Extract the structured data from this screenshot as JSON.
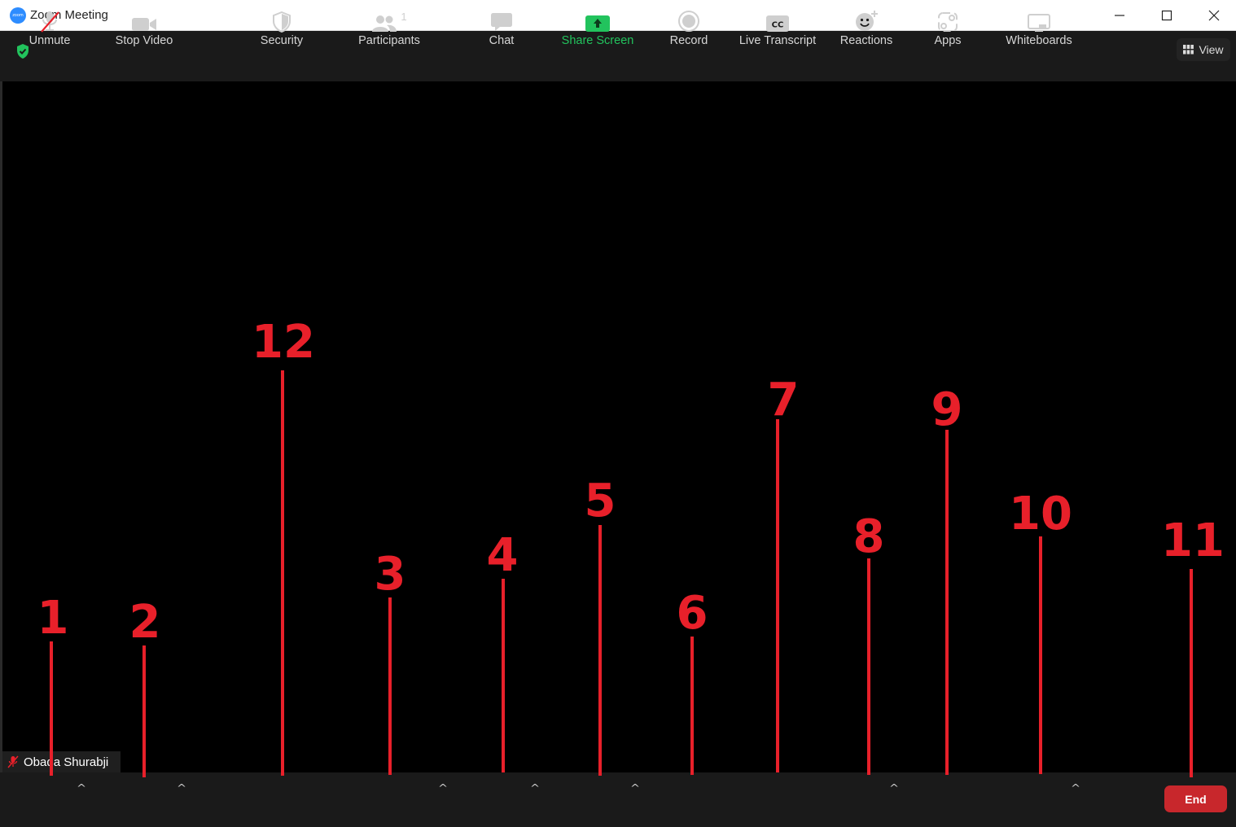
{
  "window": {
    "title": "Zoom Meeting",
    "logo_text": "zoom",
    "controls": [
      "minimize-icon",
      "maximize-icon",
      "close-icon"
    ]
  },
  "topbar": {
    "security_badge_icon": "shield-check-icon",
    "view_label": "View"
  },
  "participant": {
    "name": "Obada Shurabji",
    "muted": true
  },
  "toolbar": {
    "unmute": "Unmute",
    "stop_video": "Stop Video",
    "security": "Security",
    "participants": "Participants",
    "participants_count": "1",
    "chat": "Chat",
    "share_screen": "Share Screen",
    "record": "Record",
    "live_transcript": "Live Transcript",
    "reactions": "Reactions",
    "apps": "Apps",
    "whiteboards": "Whiteboards",
    "end": "End"
  },
  "annotations": [
    "1",
    "2",
    "3",
    "4",
    "5",
    "6",
    "7",
    "8",
    "9",
    "10",
    "11",
    "12"
  ],
  "colors": {
    "annotation": "#e8202a",
    "share_green": "#22c35d",
    "end_red": "#c8272c",
    "zoom_blue": "#2d8cff"
  }
}
